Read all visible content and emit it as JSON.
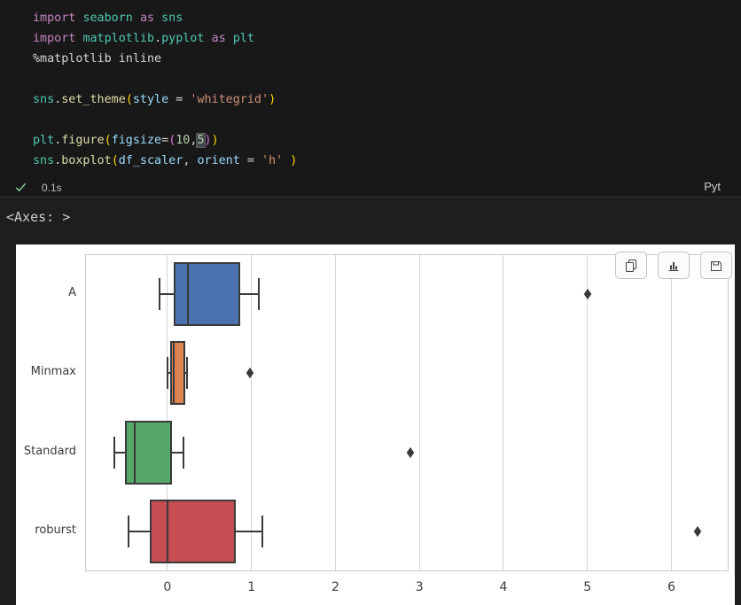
{
  "editor": {
    "language_label": "Pyt",
    "execution": {
      "status": "success",
      "duration": "0.1s"
    },
    "code_lines": [
      [
        {
          "t": "import",
          "c": "kw"
        },
        {
          "t": " ",
          "c": "pl"
        },
        {
          "t": "seaborn",
          "c": "mod"
        },
        {
          "t": " ",
          "c": "pl"
        },
        {
          "t": "as",
          "c": "kw"
        },
        {
          "t": " ",
          "c": "pl"
        },
        {
          "t": "sns",
          "c": "mod"
        }
      ],
      [
        {
          "t": "import",
          "c": "kw"
        },
        {
          "t": " ",
          "c": "pl"
        },
        {
          "t": "matplotlib",
          "c": "mod"
        },
        {
          "t": ".",
          "c": "pl"
        },
        {
          "t": "pyplot",
          "c": "mod"
        },
        {
          "t": " ",
          "c": "pl"
        },
        {
          "t": "as",
          "c": "kw"
        },
        {
          "t": " ",
          "c": "pl"
        },
        {
          "t": "plt",
          "c": "mod"
        }
      ],
      [
        {
          "t": "%matplotlib inline",
          "c": "pl"
        }
      ],
      [],
      [
        {
          "t": "sns",
          "c": "mod"
        },
        {
          "t": ".",
          "c": "pl"
        },
        {
          "t": "set_theme",
          "c": "fn"
        },
        {
          "t": "(",
          "c": "b1"
        },
        {
          "t": "style",
          "c": "var"
        },
        {
          "t": " = ",
          "c": "pl"
        },
        {
          "t": "'whitegrid'",
          "c": "str"
        },
        {
          "t": ")",
          "c": "b1"
        }
      ],
      [],
      [
        {
          "t": "plt",
          "c": "mod"
        },
        {
          "t": ".",
          "c": "pl"
        },
        {
          "t": "figure",
          "c": "fn"
        },
        {
          "t": "(",
          "c": "b1"
        },
        {
          "t": "figsize",
          "c": "var"
        },
        {
          "t": "=",
          "c": "pl"
        },
        {
          "t": "(",
          "c": "b2"
        },
        {
          "t": "10",
          "c": "num"
        },
        {
          "t": ",",
          "c": "pl"
        },
        {
          "t": "5",
          "c": "num",
          "hl": true
        },
        {
          "t": ")",
          "c": "b2"
        },
        {
          "t": ")",
          "c": "b1"
        }
      ],
      [
        {
          "t": "sns",
          "c": "mod"
        },
        {
          "t": ".",
          "c": "pl"
        },
        {
          "t": "boxplot",
          "c": "fn"
        },
        {
          "t": "(",
          "c": "b1"
        },
        {
          "t": "df_scaler",
          "c": "var"
        },
        {
          "t": ", ",
          "c": "pl"
        },
        {
          "t": "orient",
          "c": "var"
        },
        {
          "t": " = ",
          "c": "pl"
        },
        {
          "t": "'h'",
          "c": "str"
        },
        {
          "t": " ",
          "c": "pl"
        },
        {
          "t": ")",
          "c": "b1"
        }
      ]
    ]
  },
  "palette": {
    "kw": "#C586C0",
    "mod": "#4EC9B0",
    "fn": "#DCDCAA",
    "var": "#9CDCFE",
    "str": "#CE9178",
    "num": "#B5CEA8",
    "pl": "#D4D4D4",
    "b1": "#FFD700",
    "b2": "#DA70D6"
  },
  "status_colors": {
    "success_check": "#7cc88f"
  },
  "output": {
    "text_result": "<Axes: >",
    "toolbar_icons": [
      "copy-icon",
      "bar-chart-icon",
      "save-icon"
    ]
  },
  "chart_data": {
    "type": "boxplot",
    "orientation": "horizontal",
    "title": "",
    "xlabel": "",
    "ylabel": "",
    "style": "whitegrid",
    "grid": "vertical-only",
    "categories": [
      "A",
      "Minmax",
      "Standard",
      "roburst"
    ],
    "boxes": [
      {
        "category": "A",
        "color": "#4C72B0",
        "whisker_low": -0.09,
        "q1": 0.09,
        "median": 0.24,
        "q3": 0.86,
        "whisker_high": 1.09,
        "outliers": [
          5.0
        ]
      },
      {
        "category": "Minmax",
        "color": "#DD8452",
        "whisker_low": 0.0,
        "q1": 0.04,
        "median": 0.08,
        "q3": 0.2,
        "whisker_high": 0.23,
        "outliers": [
          0.98
        ]
      },
      {
        "category": "Standard",
        "color": "#55A868",
        "whisker_low": -0.63,
        "q1": -0.49,
        "median": -0.39,
        "q3": 0.04,
        "whisker_high": 0.19,
        "outliers": [
          2.89
        ]
      },
      {
        "category": "roburst",
        "color": "#C44E52",
        "whisker_low": -0.46,
        "q1": -0.2,
        "median": 0.0,
        "q3": 0.8,
        "whisker_high": 1.13,
        "outliers": [
          6.31
        ]
      }
    ],
    "x_ticks": [
      "0",
      "1",
      "2",
      "3",
      "4",
      "5",
      "6"
    ],
    "x_tick_values": [
      0,
      1,
      2,
      3,
      4,
      5,
      6
    ],
    "xlim": [
      -0.98,
      6.68
    ],
    "colors": {
      "grid": "#d4d4d4",
      "frame": "#c9c9c9",
      "box_edge": "#3a3a3a",
      "tick_label": "#3a3a3a"
    }
  }
}
